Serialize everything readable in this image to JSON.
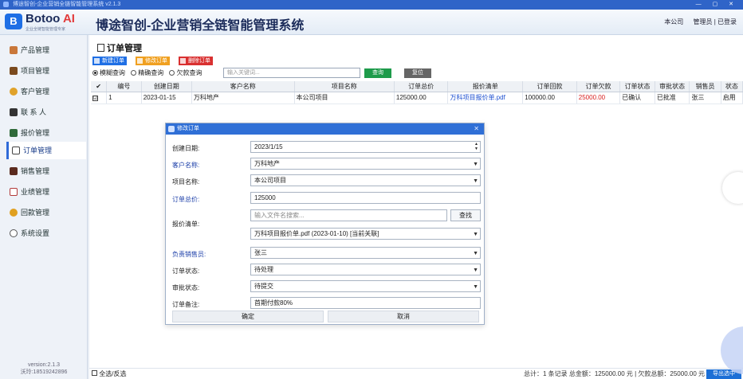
{
  "window": {
    "title": "博途智创-企业营销全链智能管理系统 v2.1.3",
    "controls": "— ▢ ✕"
  },
  "header": {
    "logo_letter": "B",
    "logo_name": "Botoo",
    "logo_ai": "AI",
    "logo_sub": "企业全链智能管理专家",
    "app_title": "博途智创-企业营销全链智能管理系统",
    "company": "本公司",
    "user": "管理员 | 已登录"
  },
  "sidebar": {
    "items": [
      {
        "label": "产品管理",
        "icon": "box-icon",
        "color": "#c9773a"
      },
      {
        "label": "项目管理",
        "icon": "folder-icon",
        "color": "#7a4a1e"
      },
      {
        "label": "客户管理",
        "icon": "heart-icon",
        "color": "#e0a22a"
      },
      {
        "label": "联 系 人",
        "icon": "contacts-icon",
        "color": "#333333"
      },
      {
        "label": "报价管理",
        "icon": "quote-icon",
        "color": "#2f6a3a"
      },
      {
        "label": "订单管理",
        "icon": "order-icon",
        "color": "#444444"
      },
      {
        "label": "销售管理",
        "icon": "briefcase-icon",
        "color": "#5a2a1e"
      },
      {
        "label": "业绩管理",
        "icon": "chart-icon",
        "color": "#b23a3a"
      },
      {
        "label": "回款管理",
        "icon": "money-icon",
        "color": "#e0a020"
      },
      {
        "label": "系统设置",
        "icon": "gear-icon",
        "color": "#555555"
      }
    ],
    "active_index": 5,
    "version": "version:2.1.3",
    "contact": "沃玲:18519242896"
  },
  "page": {
    "title": "订单管理",
    "toolbar": {
      "new_label": "新建订单",
      "edit_label": "修改订单",
      "delete_label": "删除订单"
    },
    "search": {
      "modes": [
        "模糊查询",
        "精确查询",
        "欠款查询"
      ],
      "selected_mode": 0,
      "placeholder": "输入关键词...",
      "query_label": "查询",
      "reset_label": "复位"
    },
    "table": {
      "headers": [
        "✔",
        "编号",
        "创建日期",
        "客户名称",
        "项目名称",
        "订单总价",
        "报价清单",
        "订单回款",
        "订单欠款",
        "订单状态",
        "审批状态",
        "销售员",
        "状态"
      ],
      "rows": [
        {
          "checked": "☑",
          "id": "1",
          "date": "2023-01-15",
          "customer": "万科地产",
          "project": "本公司项目",
          "total": "125000.00",
          "quote": "万科项目报价单.pdf",
          "received": "100000.00",
          "owed": "25000.00",
          "order_status": "已确认",
          "approval": "已批准",
          "sales": "张三",
          "status": "启用"
        }
      ]
    },
    "footer": {
      "select_all": "全选/反选",
      "summary": "总计：1 条记录  总金额：125000.00 元 | 欠款总额：25000.00 元",
      "export_label": "导出选中"
    }
  },
  "modal": {
    "title": "修改订单",
    "close": "✕",
    "fields": {
      "created_label": "创建日期:",
      "created_value": "2023/1/15",
      "customer_label": "客户名称:",
      "customer_value": "万科地产",
      "project_label": "项目名称:",
      "project_value": "本公司项目",
      "total_label": "订单总价:",
      "total_value": "125000",
      "quote_label": "报价清单:",
      "file_placeholder": "输入文件名搜索...",
      "find_label": "查找",
      "quote_value": "万科项目报价单.pdf (2023-01-10) [当前关联]",
      "sales_label": "负责销售员:",
      "sales_value": "张三",
      "order_status_label": "订单状态:",
      "order_status_value": "待处理",
      "approval_label": "审批状态:",
      "approval_value": "待提交",
      "note_label": "订单备注:",
      "note_value": "首期付款80%"
    },
    "ok_label": "确定",
    "cancel_label": "取消"
  },
  "colors": {
    "accent": "#2f6fd6",
    "new_button": "#1f6fe5",
    "edit_button": "#f0a020",
    "delete_button": "#d93030",
    "query_button": "#1e9b4b",
    "reset_button": "#666666",
    "owed_text": "#d81f1f"
  }
}
